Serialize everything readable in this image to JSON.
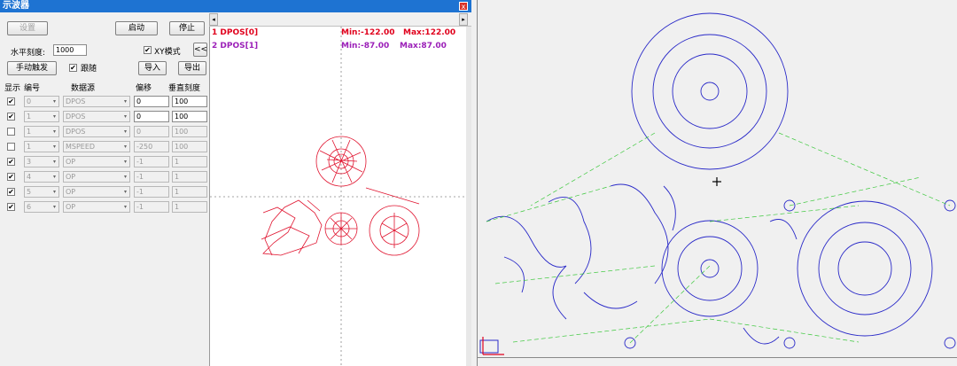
{
  "window": {
    "title": "示波器",
    "close": "x"
  },
  "toolbar": {
    "settings": "设置",
    "start": "启动",
    "stop": "停止",
    "xy_mode": "XY模式",
    "collapse": "<<",
    "manual_trigger": "手动触发",
    "follow": "跟随",
    "import": "导入",
    "export": "导出"
  },
  "horizontal_scale": {
    "label": "水平刻度:",
    "value": "1000"
  },
  "columns": {
    "show": "显示",
    "id": "编号",
    "source": "数据源",
    "offset": "偏移",
    "vscale": "垂直刻度"
  },
  "rows": [
    {
      "checked": true,
      "id": "0",
      "source": "DPOS",
      "offset": "0",
      "vscale": "100",
      "enabled": true
    },
    {
      "checked": true,
      "id": "1",
      "source": "DPOS",
      "offset": "0",
      "vscale": "100",
      "enabled": true
    },
    {
      "checked": false,
      "id": "1",
      "source": "DPOS",
      "offset": "0",
      "vscale": "100",
      "enabled": false
    },
    {
      "checked": false,
      "id": "1",
      "source": "MSPEED",
      "offset": "-250",
      "vscale": "100",
      "enabled": false
    },
    {
      "checked": true,
      "id": "3",
      "source": "OP",
      "offset": "-1",
      "vscale": "1",
      "enabled": false
    },
    {
      "checked": true,
      "id": "4",
      "source": "OP",
      "offset": "-1",
      "vscale": "1",
      "enabled": false
    },
    {
      "checked": true,
      "id": "5",
      "source": "OP",
      "offset": "-1",
      "vscale": "1",
      "enabled": false
    },
    {
      "checked": true,
      "id": "6",
      "source": "OP",
      "offset": "-1",
      "vscale": "1",
      "enabled": false
    }
  ],
  "legend": [
    {
      "name": "1 DPOS[0]",
      "min": "Min:-122.00",
      "max": "Max:122.00",
      "color": "#e0001c"
    },
    {
      "name": "2 DPOS[1]",
      "min": "Min:-87.00",
      "max": "Max:87.00",
      "color": "#9b1fb8"
    }
  ],
  "scroll": {
    "left": "◂",
    "right": "▸"
  },
  "colors": {
    "trace_red": "#e0142f",
    "path_blue": "#2a2ac8",
    "path_green": "#3cc83c"
  }
}
